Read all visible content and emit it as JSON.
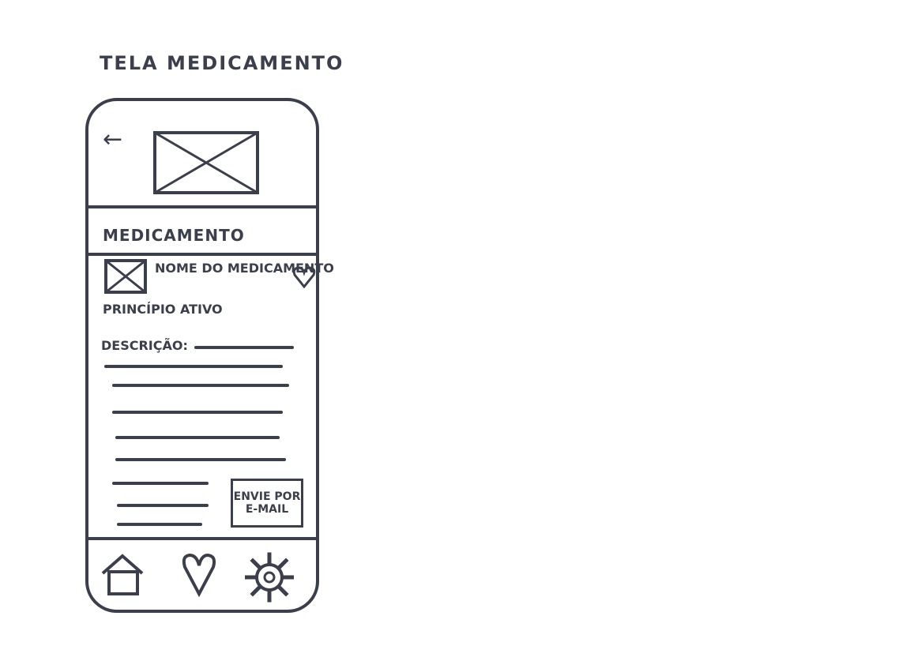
{
  "page": {
    "title": "TELA MEDICAMENTO"
  },
  "header": {
    "back_icon": "arrow-left-icon",
    "image_placeholder": "image-placeholder"
  },
  "section": {
    "title": "MEDICAMENTO"
  },
  "medication": {
    "name": "NOME DO MEDICAMENTO",
    "active_principle": "PRINCÍPIO ATIVO",
    "description_label": "DESCRIÇÃO:",
    "favorite_icon": "heart-icon"
  },
  "actions": {
    "email_line1": "ENVIE POR",
    "email_line2": "E-MAIL"
  },
  "bottom_nav": {
    "items": [
      {
        "icon": "home-icon"
      },
      {
        "icon": "heart-icon"
      },
      {
        "icon": "gear-icon"
      }
    ]
  },
  "colors": {
    "ink": "#3a3f4b",
    "paper": "#ffffff"
  }
}
